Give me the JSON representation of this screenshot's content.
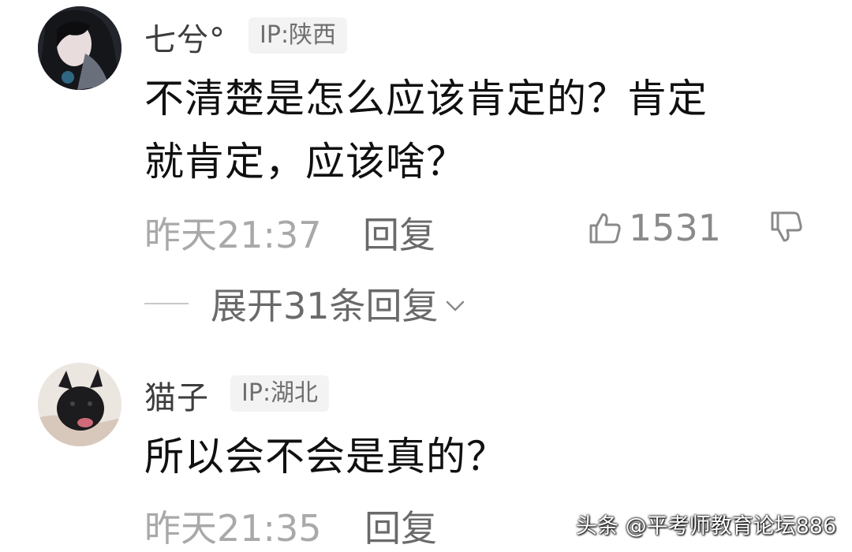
{
  "comments": [
    {
      "username": "七兮°",
      "ip": "IP:陕西",
      "text_line1": "不清楚是怎么应该肯定的？肯定",
      "text_line2": "就肯定，应该啥？",
      "time": "昨天21:37",
      "reply_label": "回复",
      "likes": "1531",
      "expand_label": "展开31条回复"
    },
    {
      "username": "猫子",
      "ip": "IP:湖北",
      "text_line1": "所以会不会是真的？",
      "time": "昨天21:35",
      "reply_label": "回复"
    }
  ],
  "watermark": "头条 @平考师教育论坛886",
  "icons": {
    "like": "thumbs-up-icon",
    "dislike": "thumbs-down-icon",
    "expand": "chevron-down-icon"
  },
  "colors": {
    "text": "#101010",
    "muted": "#a9a9a9",
    "badge_bg": "#f3f3f3"
  }
}
